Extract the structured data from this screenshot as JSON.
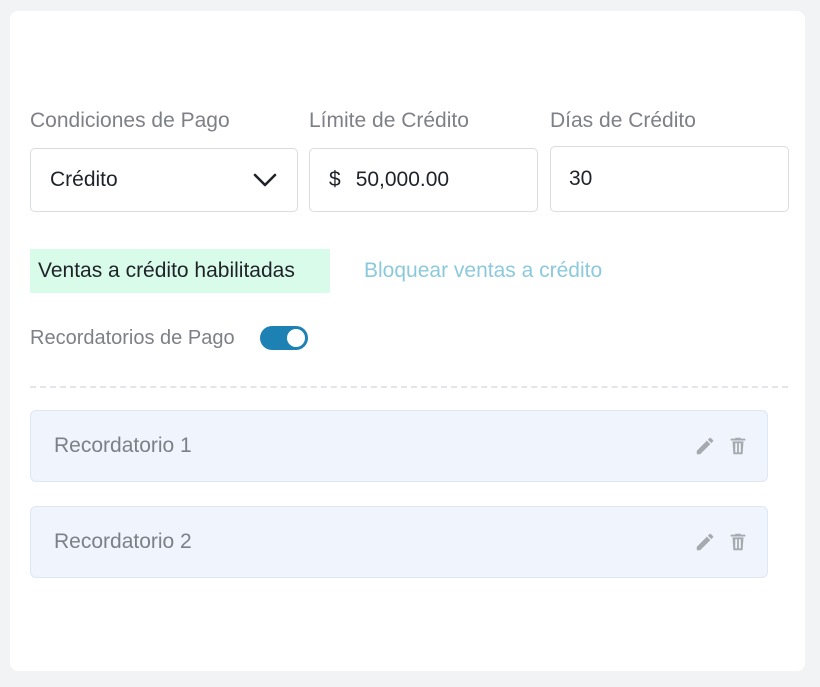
{
  "payment_terms": {
    "label": "Condiciones de Pago",
    "value": "Crédito",
    "icon": "chevron-down-icon"
  },
  "credit_limit": {
    "label": "Límite de Crédito",
    "currency": "$",
    "value": "50,000.00"
  },
  "credit_days": {
    "label": "Días de Crédito",
    "value": "30"
  },
  "credit_status": {
    "badge": "Ventas a crédito habilitadas",
    "badge_color": "#d9fbea",
    "block_link": "Bloquear ventas a crédito",
    "link_color": "#8cc9dc"
  },
  "reminders": {
    "label": "Recordatorios de Pago",
    "enabled": true,
    "toggle_color": "#1d81b4",
    "items": [
      {
        "label": "Recordatorio 1",
        "icons": [
          "pencil-icon",
          "trash-icon"
        ]
      },
      {
        "label": "Recordatorio 2",
        "icons": [
          "pencil-icon",
          "trash-icon"
        ]
      }
    ]
  }
}
